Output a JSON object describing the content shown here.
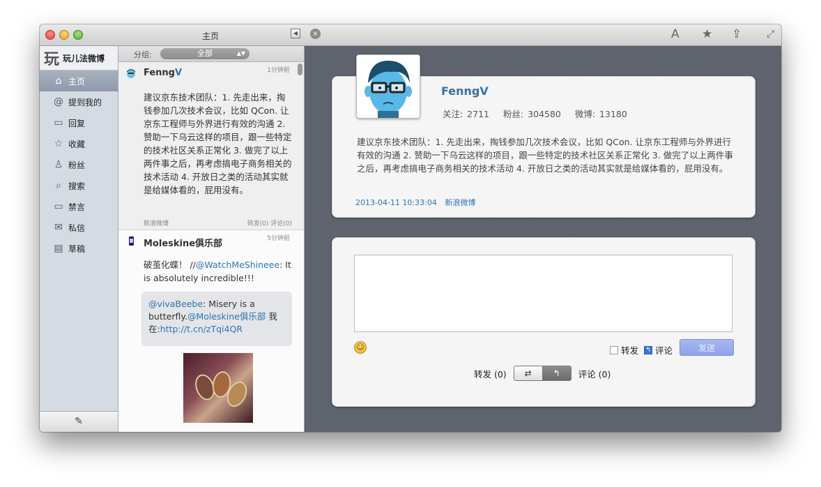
{
  "window": {
    "title": "主页"
  },
  "toolbar": {
    "back_glyph": "◀",
    "close_glyph": "×",
    "font_glyph": "A",
    "star_glyph": "★",
    "share_glyph": "⇪",
    "expand_glyph": "⤢"
  },
  "sidebar": {
    "brand_logo": "玩",
    "brand_name": "玩儿法微博",
    "items": [
      {
        "label": "主页",
        "icon": "⌂"
      },
      {
        "label": "提到我的",
        "icon": "@"
      },
      {
        "label": "回复",
        "icon": "▭"
      },
      {
        "label": "收藏",
        "icon": "☆"
      },
      {
        "label": "粉丝",
        "icon": "♙"
      },
      {
        "label": "搜索",
        "icon": "⌕"
      },
      {
        "label": "禁言",
        "icon": "▭"
      },
      {
        "label": "私信",
        "icon": "✉"
      },
      {
        "label": "草稿",
        "icon": "▤"
      }
    ],
    "compose_glyph": "✎"
  },
  "timeline": {
    "group_label": "分组:",
    "group_value": "全部",
    "group_arrow": "▲▼",
    "tweets": [
      {
        "name_prefix": "Fenng",
        "name_suffix": "V",
        "time": "1分钟前",
        "text": "建议京东技术团队：1. 先走出来，掏钱参加几次技术会议，比如 QCon. 让京东工程师与外界进行有效的沟通 2. 赞助一下乌云这样的项目，跟一些特定的技术社区关系正常化 3. 做完了以上两件事之后，再考虑搞电子商务相关的技术活动 4. 开放日之类的活动其实就是给媒体看的，屁用没有。",
        "source": "新浪微博",
        "stats": "转发(0) 评论(0)"
      },
      {
        "name": "Moleskine俱乐部",
        "time": "5分钟前",
        "text_prefix": "破茧化蝶！ //",
        "mention": "@WatchMeShineee",
        "text_suffix": ": It is absolutely incredible!!!",
        "quote": {
          "mention1": "@vivaBeebe",
          "text1": ": Misery is a butterfly.",
          "mention2": "@Moleskine俱乐部",
          "text2": " 我在:",
          "link": "http://t.cn/zTqi4QR"
        }
      }
    ]
  },
  "detail": {
    "name_prefix": "Fenng",
    "name_suffix": "V",
    "following": "关注: 2711",
    "followers": "粉丝: 304580",
    "posts": "微博: 13180",
    "text": "建议京东技术团队：1. 先走出来，掏钱参加几次技术会议，比如 QCon. 让京东工程师与外界进行有效的沟通 2. 赞助一下乌云这样的项目，跟一些特定的技术社区关系正常化 3. 做完了以上两件事之后，再考虑搞电子商务相关的技术活动 4. 开放日之类的活动其实就是给媒体看的，屁用没有。",
    "timestamp": "2013-04-11 10:33:04",
    "source": "新浪微博"
  },
  "reply": {
    "emoji_glyph": "☺",
    "repost_label": "转发",
    "comment_label": "评论",
    "comment_checked_glyph": "↰",
    "send_label": "发送",
    "repost_count": "转发 (0)",
    "comment_count": "评论 (0)",
    "seg_repost_glyph": "⇄",
    "seg_comment_glyph": "↰"
  }
}
